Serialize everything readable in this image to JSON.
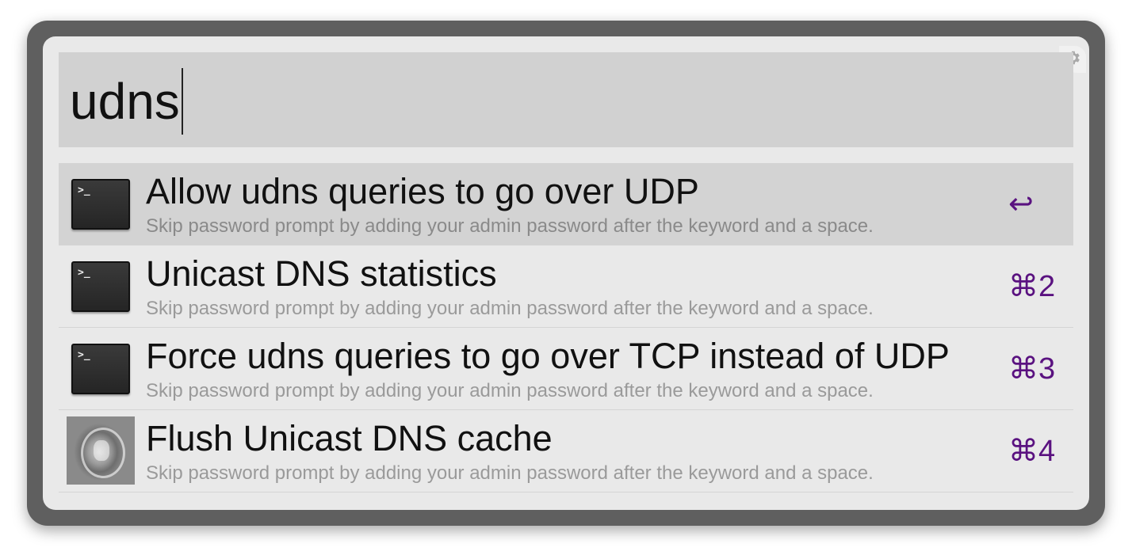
{
  "search": {
    "query": "udns"
  },
  "settings": {
    "icon": "gear-icon"
  },
  "results": [
    {
      "title": "Allow udns queries to go over UDP",
      "subtitle": "Skip password prompt by adding your admin password after the keyword and a space.",
      "shortcut": "↩",
      "icon": "terminal-icon",
      "selected": true
    },
    {
      "title": "Unicast DNS statistics",
      "subtitle": "Skip password prompt by adding your admin password after the keyword and a space.",
      "shortcut": "⌘2",
      "icon": "terminal-icon",
      "selected": false
    },
    {
      "title": "Force udns queries to go over TCP instead of UDP",
      "subtitle": "Skip password prompt by adding your admin password after the keyword and a space.",
      "shortcut": "⌘3",
      "icon": "terminal-icon",
      "selected": false
    },
    {
      "title": "Flush Unicast DNS cache",
      "subtitle": "Skip password prompt by adding your admin password after the keyword and a space.",
      "shortcut": "⌘4",
      "icon": "toilet-flush-icon",
      "selected": false
    }
  ],
  "colors": {
    "frame": "#5f5f5f",
    "panel": "#e9e9e9",
    "search_bg": "#d1d1d1",
    "selected_row": "#d3d3d3",
    "shortcut": "#5a1280",
    "subtitle": "#9a9a9a"
  }
}
